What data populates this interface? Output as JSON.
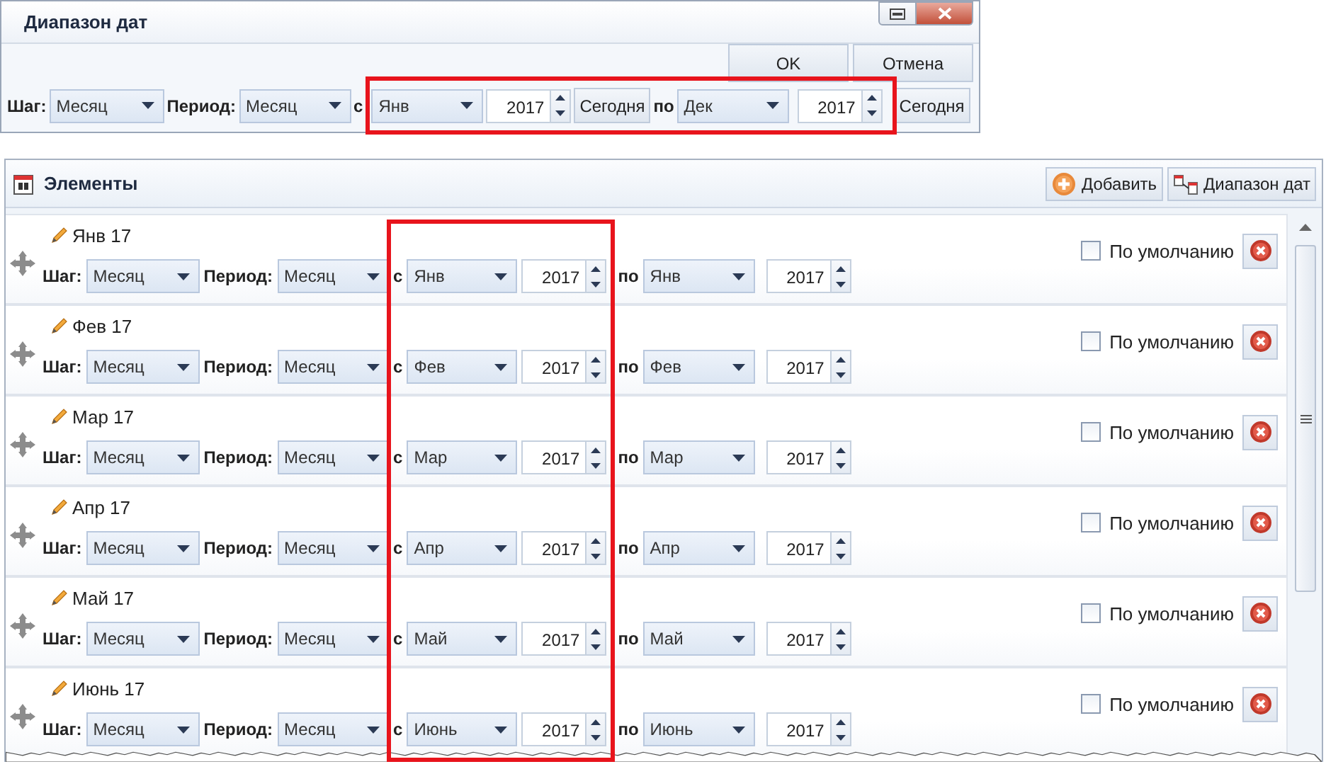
{
  "dialog": {
    "title": "Диапазон дат",
    "buttons": [
      "OK",
      "Отмена"
    ],
    "step_label": "Шаг:",
    "step": "Месяц",
    "period_label": "Период:",
    "period": "Месяц",
    "from_label": "с",
    "from_month": "Янв",
    "from_year": "2017",
    "from_today": "Сегодня",
    "to_label": "по",
    "to_month": "Дек",
    "to_year": "2017",
    "to_today": "Сегодня"
  },
  "panel": {
    "title": "Элементы",
    "buttons": [
      "Добавить",
      "Диапазон дат"
    ],
    "items": [
      {
        "name": "Янв 17",
        "step_label": "Шаг:",
        "step": "Месяц",
        "period_label": "Период:",
        "period": "Месяц",
        "from_label": "с",
        "from_month": "Янв",
        "from_year": "2017",
        "to_label": "по",
        "to_month": "Янв",
        "to_year": "2017",
        "default_label": "По умолчанию",
        "default_checked": false
      },
      {
        "name": "Фев 17",
        "step_label": "Шаг:",
        "step": "Месяц",
        "period_label": "Период:",
        "period": "Месяц",
        "from_label": "с",
        "from_month": "Фев",
        "from_year": "2017",
        "to_label": "по",
        "to_month": "Фев",
        "to_year": "2017",
        "default_label": "По умолчанию",
        "default_checked": false
      },
      {
        "name": "Мар 17",
        "step_label": "Шаг:",
        "step": "Месяц",
        "period_label": "Период:",
        "period": "Месяц",
        "from_label": "с",
        "from_month": "Мар",
        "from_year": "2017",
        "to_label": "по",
        "to_month": "Мар",
        "to_year": "2017",
        "default_label": "По умолчанию",
        "default_checked": false
      },
      {
        "name": "Апр 17",
        "step_label": "Шаг:",
        "step": "Месяц",
        "period_label": "Период:",
        "period": "Месяц",
        "from_label": "с",
        "from_month": "Апр",
        "from_year": "2017",
        "to_label": "по",
        "to_month": "Апр",
        "to_year": "2017",
        "default_label": "По умолчанию",
        "default_checked": false
      },
      {
        "name": "Май 17",
        "step_label": "Шаг:",
        "step": "Месяц",
        "period_label": "Период:",
        "period": "Месяц",
        "from_label": "с",
        "from_month": "Май",
        "from_year": "2017",
        "to_label": "по",
        "to_month": "Май",
        "to_year": "2017",
        "default_label": "По умолчанию",
        "default_checked": false
      },
      {
        "name": "Июнь 17",
        "step_label": "Шаг:",
        "step": "Месяц",
        "period_label": "Период:",
        "period": "Месяц",
        "from_label": "с",
        "from_month": "Июнь",
        "from_year": "2017",
        "to_label": "по",
        "to_month": "Июнь",
        "to_year": "2017",
        "default_label": "По умолчанию",
        "default_checked": false
      }
    ]
  }
}
